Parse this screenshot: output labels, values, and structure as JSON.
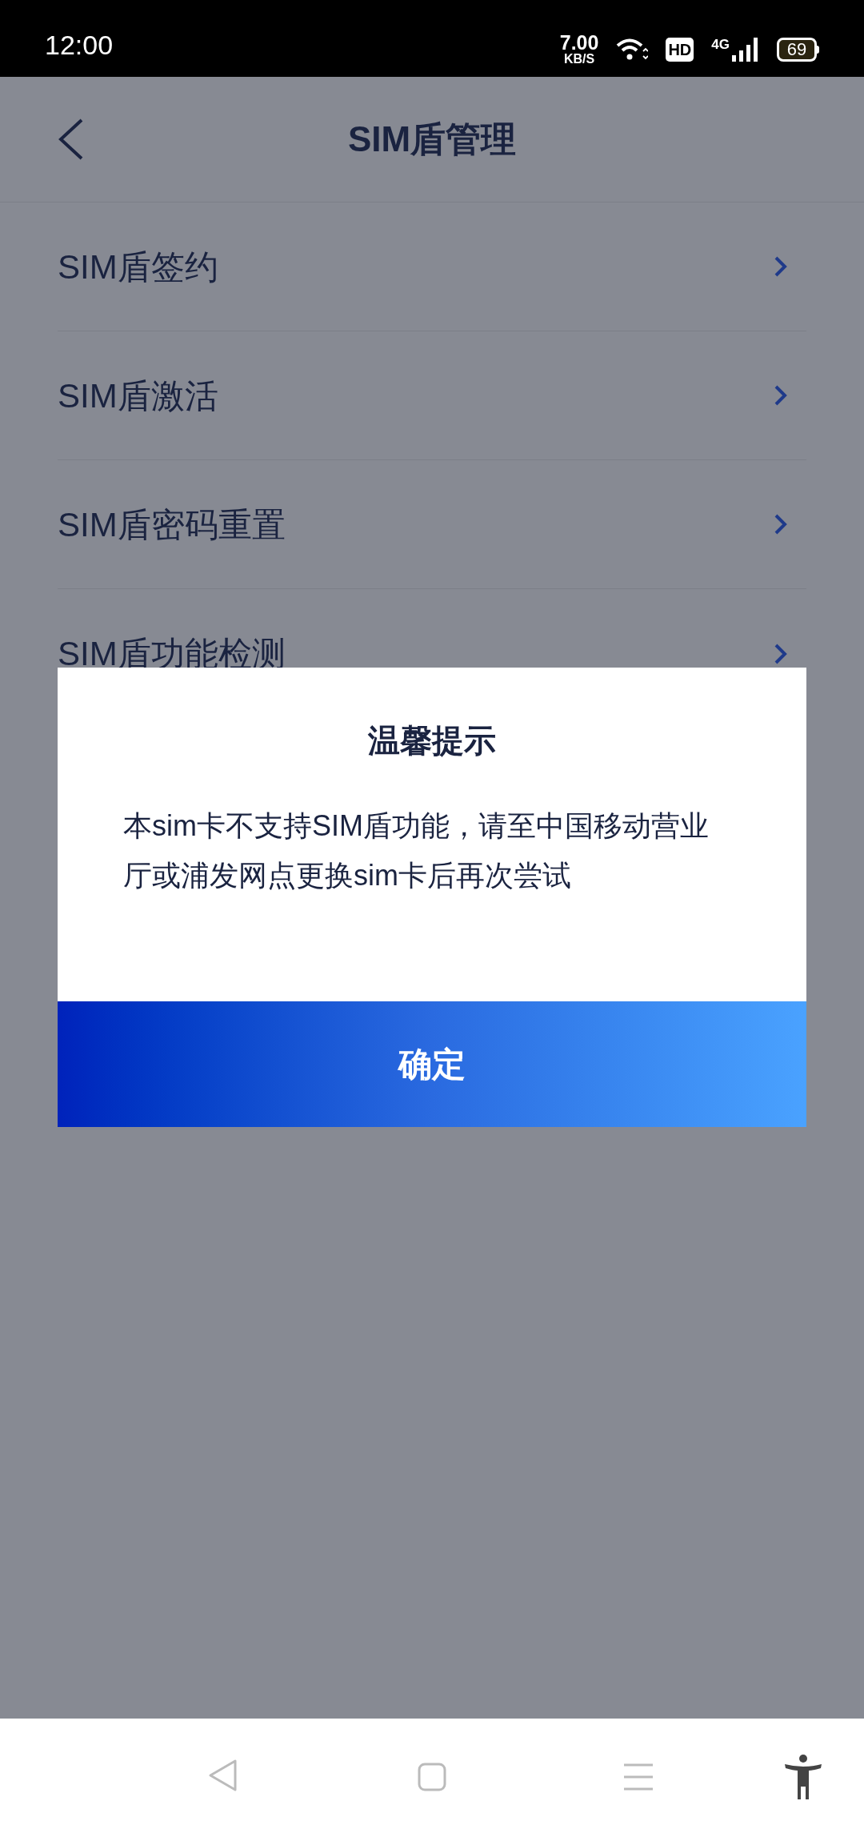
{
  "status_bar": {
    "time": "12:00",
    "net_speed": "7.00",
    "net_unit": "KB/S",
    "hd": "HD",
    "network": "4G",
    "battery": "69"
  },
  "header": {
    "title": "SIM盾管理"
  },
  "items": [
    {
      "label": "SIM盾签约"
    },
    {
      "label": "SIM盾激活"
    },
    {
      "label": "SIM盾密码重置"
    },
    {
      "label": "SIM盾功能检测"
    }
  ],
  "dialog": {
    "title": "温馨提示",
    "message": "本sim卡不支持SIM盾功能，请至中国移动营业厅或浦发网点更换sim卡后再次尝试",
    "confirm": "确定"
  }
}
